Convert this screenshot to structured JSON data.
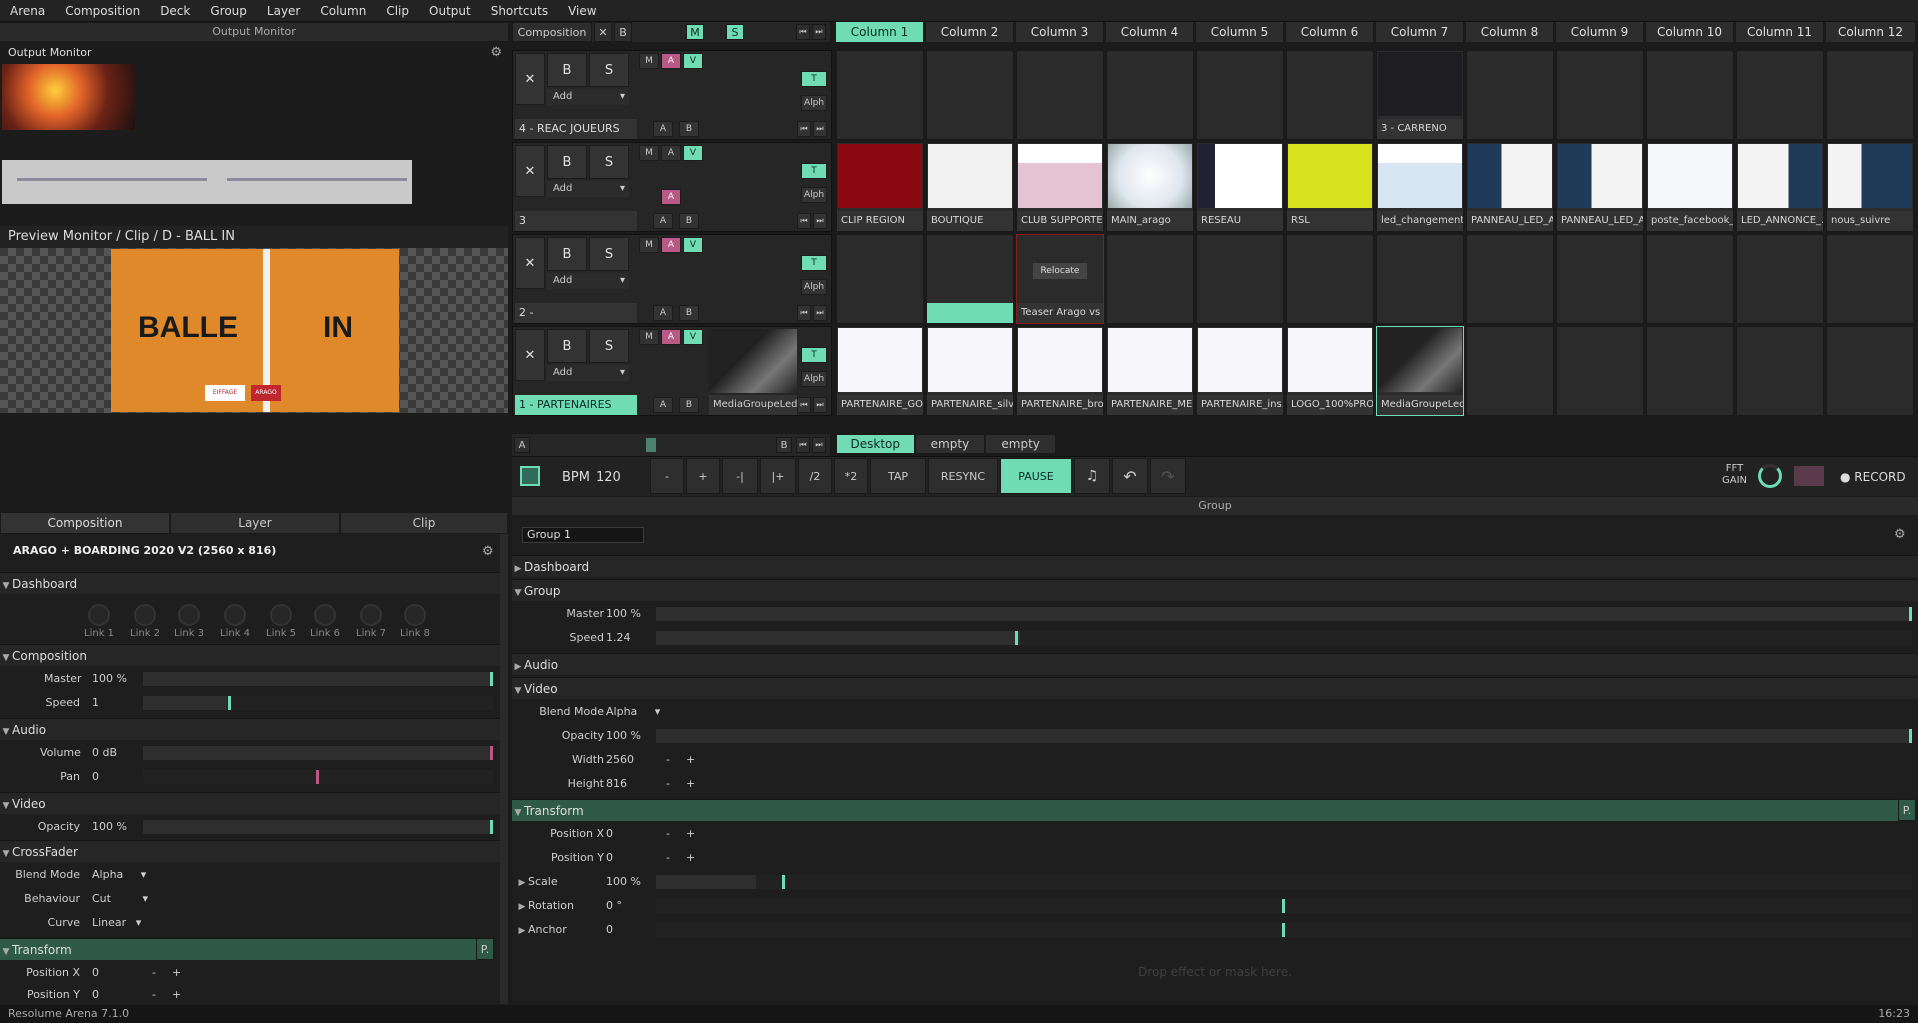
{
  "menu": [
    "Arena",
    "Composition",
    "Deck",
    "Group",
    "Layer",
    "Column",
    "Clip",
    "Output",
    "Shortcuts",
    "View"
  ],
  "left": {
    "output_header": "Output Monitor",
    "output_title": "Output Monitor",
    "preview_title": "Preview Monitor / Clip / D - BALL IN",
    "preview_text_left": "BALLE",
    "preview_text_right": "IN",
    "preview_logo_1": "EIFFAGE",
    "preview_logo_2": "ARAGO",
    "tabs": [
      "Composition",
      "Layer",
      "Clip"
    ],
    "comp_title": "ARAGO + BOARDING 2020 V2 (2560 x 816)",
    "dashboard": "Dashboard",
    "links": [
      "Link 1",
      "Link 2",
      "Link 3",
      "Link 4",
      "Link 5",
      "Link 6",
      "Link 7",
      "Link 8"
    ],
    "sec_composition": "Composition",
    "master_label": "Master",
    "master_value": "100 %",
    "speed_label": "Speed",
    "speed_value": "1",
    "sec_audio": "Audio",
    "volume_label": "Volume",
    "volume_value": "0 dB",
    "pan_label": "Pan",
    "pan_value": "0",
    "sec_video": "Video",
    "opacity_label": "Opacity",
    "opacity_value": "100 %",
    "sec_crossfader": "CrossFader",
    "blend_label": "Blend Mode",
    "blend_value": "Alpha",
    "behaviour_label": "Behaviour",
    "behaviour_value": "Cut",
    "curve_label": "Curve",
    "curve_value": "Linear",
    "sec_transform": "Transform",
    "transform_p": "P.",
    "posx_label": "Position X",
    "posx_value": "0",
    "posy_label": "Position Y",
    "posy_value": "0",
    "plus": "+",
    "minus": "-"
  },
  "deck": {
    "composition_btn": "Composition",
    "x": "✕",
    "b": "B",
    "m": "M",
    "s": "S",
    "columns": [
      "Column 1",
      "Column 2",
      "Column 3",
      "Column 4",
      "Column 5",
      "Column 6",
      "Column 7",
      "Column 8",
      "Column 9",
      "Column 10",
      "Column 11",
      "Column 12"
    ],
    "layers": [
      {
        "name": "4 - REAC JOUEURS",
        "add": "Add",
        "clips": [
          "",
          "",
          "",
          "",
          "",
          "",
          "3 - CARRENO",
          "",
          "",
          "",
          "",
          ""
        ]
      },
      {
        "name": "3",
        "add": "Add",
        "clips": [
          "CLIP REGION",
          "BOUTIQUE",
          "CLUB SUPPORTER",
          "MAIN_arago",
          "RESEAU",
          "RSL",
          "led_changement...",
          "PANNEAU_LED_A...",
          "PANNEAU_LED_A...",
          "poste_facebook_...",
          "LED_ANNONCE_...",
          "nous_suivre"
        ]
      },
      {
        "name": "2 -",
        "add": "Add",
        "clips": [
          "",
          "",
          "Teaser Arago vs ...",
          "",
          "",
          "",
          "",
          "",
          "",
          "",
          "",
          ""
        ]
      },
      {
        "name": "1 - PARTENAIRES",
        "add": "Add",
        "clips": [
          "PARTENAIRE_GO...",
          "PARTENAIRE_silv...",
          "PARTENAIRE_bro...",
          "PARTENAIRE_ME...",
          "PARTENAIRE_ins...",
          "LOGO_100%PRO...",
          "MediaGroupeLed...",
          "",
          "",
          "",
          "",
          ""
        ]
      }
    ],
    "layer1_preview": "MediaGroupeLed...",
    "relocate": "Relocate",
    "lc_m": "M",
    "lc_a": "A",
    "lc_v": "V",
    "lc_t": "T",
    "lc_alph": "Alph",
    "ab_a": "A",
    "ab_b": "B",
    "deck_tabs": [
      "Desktop",
      "empty",
      "empty"
    ]
  },
  "transport": {
    "bpm_label": "BPM",
    "bpm_value": "120",
    "minus": "-",
    "plus": "+",
    "nudge_l": "-|",
    "nudge_r": "|+",
    "half": "/2",
    "double": "*2",
    "tap": "TAP",
    "resync": "RESYNC",
    "pause": "PAUSE",
    "fft": "FFT",
    "gain": "GAIN",
    "record": "● RECORD"
  },
  "group_panel": {
    "header": "Group",
    "name_field": "Group 1",
    "dashboard": "Dashboard",
    "sec_group": "Group",
    "master_label": "Master",
    "master_value": "100 %",
    "speed_label": "Speed",
    "speed_value": "1.24",
    "sec_audio": "Audio",
    "sec_video": "Video",
    "blend_label": "Blend Mode",
    "blend_value": "Alpha",
    "opacity_label": "Opacity",
    "opacity_value": "100 %",
    "width_label": "Width",
    "width_value": "2560",
    "height_label": "Height",
    "height_value": "816",
    "sec_transform": "Transform",
    "transform_p": "P.",
    "posx_label": "Position X",
    "posx_value": "0",
    "posy_label": "Position Y",
    "posy_value": "0",
    "scale_label": "Scale",
    "scale_value": "100 %",
    "rotation_label": "Rotation",
    "rotation_value": "0 °",
    "anchor_label": "Anchor",
    "anchor_value": "0",
    "drop_hint": "Drop effect or mask here."
  },
  "status": {
    "app": "Resolume Arena 7.1.0",
    "time": "16:23"
  },
  "colors": {
    "accent": "#6fdcb6",
    "pink": "#b85a84",
    "orange": "#e0892a"
  },
  "controls": {
    "group_speed_fraction": 0.29,
    "comp_speed_fraction": 0.25,
    "pan_fraction": 0.5
  }
}
